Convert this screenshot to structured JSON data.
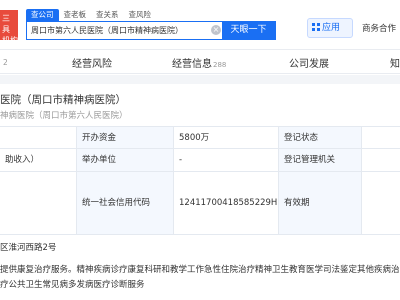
{
  "header": {
    "logo_text": "三 具 机构",
    "search_tabs": [
      "查公司",
      "查老板",
      "查关系",
      "查风险"
    ],
    "search_value": "周口市第六人民医院（周口市精神病医院）",
    "search_button": "天眼一下",
    "app_button": "应用",
    "business_coop": "商务合作"
  },
  "nav": {
    "left_count": "2",
    "tabs": [
      {
        "label": "经营风险",
        "count": ""
      },
      {
        "label": "经营信息",
        "count": "288"
      },
      {
        "label": "公司发展",
        "count": ""
      },
      {
        "label": "知",
        "count": ""
      }
    ]
  },
  "company": {
    "name": "医院（周口市精神病医院）",
    "alias": "神病医院（周口市第六人民医院）"
  },
  "table": {
    "rows": [
      {
        "c1": "",
        "l2": "开办资金",
        "v2": "5800万",
        "l3": "登记状态",
        "v3": ""
      },
      {
        "c1": "助收入）",
        "l2": "举办单位",
        "v2": "-",
        "l3": "登记管理机关",
        "v3": ""
      },
      {
        "c1": "",
        "l2": "统一社会信用代码",
        "v2": "12411700418585229H",
        "l3": "有效期",
        "v3": ""
      }
    ]
  },
  "address": "区淮河西路2号",
  "scope": [
    "提供康复治疗服务。精神疾病诊疗康复科研和教学工作急性住院治疗精神卫生教育医学司法鉴定其他疾病治",
    "疗公共卫生常见病多发病医疗诊断服务"
  ],
  "colors": {
    "accent": "#1a6ff3",
    "label_bg": "#f4f8fe",
    "logo_bg": "#e84b3c"
  }
}
